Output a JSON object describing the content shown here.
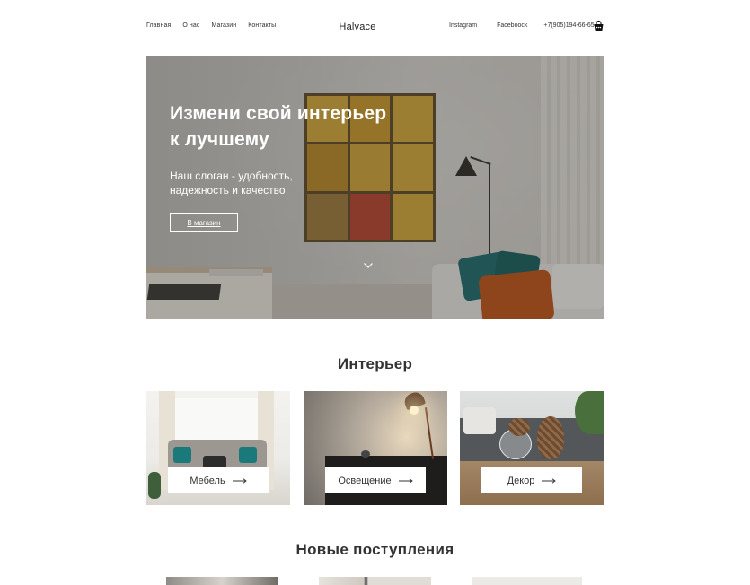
{
  "header": {
    "nav": [
      "Главная",
      "О нас",
      "Магазин",
      "Контакты"
    ],
    "brand": "Halvace",
    "links": {
      "instagram": "Instagram",
      "facebook": "Faceboock",
      "phone": "+7(905)194-66-65"
    },
    "cart_icon": "shopping-bag-icon"
  },
  "hero": {
    "title_lines": [
      "Измени свой интерьер",
      "к лучшему"
    ],
    "subtitle_lines": [
      "Наш слоган - удобность,",
      "надежность и качество"
    ],
    "button": "В магазин",
    "scroll_icon": "chevron-down-icon"
  },
  "interior": {
    "title": "Интерьер",
    "cards": [
      {
        "label": "Мебель",
        "icon": "arrow-right-icon"
      },
      {
        "label": "Освещение",
        "icon": "arrow-right-icon"
      },
      {
        "label": "Декор",
        "icon": "arrow-right-icon"
      }
    ]
  },
  "new_arrivals": {
    "title": "Новые поступления"
  },
  "colors": {
    "text": "#222222",
    "hero_overlay": "#28262352",
    "teal_accent": "#1a7a79",
    "orange_accent": "#c0541a"
  }
}
